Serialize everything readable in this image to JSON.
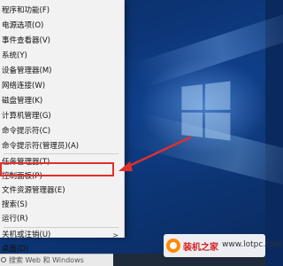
{
  "menu": {
    "items": [
      {
        "label": "程序和功能(F)"
      },
      {
        "label": "电源选项(O)"
      },
      {
        "label": "事件查看器(V)"
      },
      {
        "label": "系统(Y)"
      },
      {
        "label": "设备管理器(M)"
      },
      {
        "label": "网络连接(W)"
      },
      {
        "label": "磁盘管理(K)"
      },
      {
        "label": "计算机管理(G)"
      },
      {
        "label": "命令提示符(C)"
      },
      {
        "label": "命令提示符(管理员)(A)"
      },
      {
        "label": "任务管理器(T)"
      },
      {
        "label": "控制面板(P)"
      },
      {
        "label": "文件资源管理器(E)"
      },
      {
        "label": "搜索(S)"
      },
      {
        "label": "运行(R)"
      },
      {
        "label": "关机或注销(U)",
        "submenu_arrow": ">"
      },
      {
        "label": "桌面(D)"
      }
    ],
    "highlighted_item": "控制面板(P)"
  },
  "taskbar": {
    "search_placeholder": "搜索 Web 和 Windows"
  },
  "watermark": {
    "brand": "装机之家",
    "domain": "www.lotpc.com"
  },
  "colors": {
    "highlight": "#e0302a",
    "menu_bg": "#f2f2f2",
    "desktop": "#0e3d86"
  }
}
